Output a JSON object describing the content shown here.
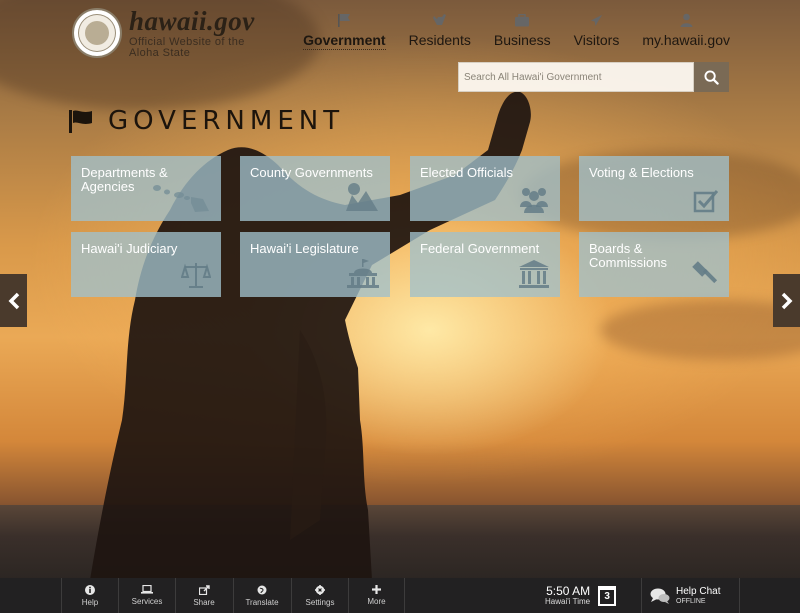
{
  "logo": {
    "title": "hawaii.gov",
    "subtitle_line1": "Official Website of the",
    "subtitle_line2": "Aloha State"
  },
  "nav": [
    {
      "label": "Government",
      "icon": "flag-icon",
      "active": true
    },
    {
      "label": "Residents",
      "icon": "shaka-icon",
      "active": false
    },
    {
      "label": "Business",
      "icon": "briefcase-icon",
      "active": false
    },
    {
      "label": "Visitors",
      "icon": "airplane-icon",
      "active": false
    },
    {
      "label": "my.hawaii.gov",
      "icon": "user-icon",
      "active": false
    }
  ],
  "search": {
    "placeholder": "Search All Hawai'i Government",
    "icon": "search-icon"
  },
  "heading": {
    "title": "GOVERNMENT",
    "icon": "flag-icon"
  },
  "tiles": [
    {
      "label": "Departments & Agencies",
      "icon": "islands-icon"
    },
    {
      "label": "County Governments",
      "icon": "county-map-icon"
    },
    {
      "label": "Elected Officials",
      "icon": "people-group-icon"
    },
    {
      "label": "Voting & Elections",
      "icon": "checkbox-icon"
    },
    {
      "label": "Hawai'i Judiciary",
      "icon": "scales-icon"
    },
    {
      "label": "Hawai'i Legislature",
      "icon": "capitol-icon"
    },
    {
      "label": "Federal Government",
      "icon": "columns-building-icon"
    },
    {
      "label": "Boards & Commissions",
      "icon": "gavel-icon"
    }
  ],
  "carousel": {
    "prev_icon": "chevron-left-icon",
    "next_icon": "chevron-right-icon"
  },
  "bottombar": {
    "items": [
      {
        "label": "Help",
        "icon": "info-icon"
      },
      {
        "label": "Services",
        "icon": "laptop-icon"
      },
      {
        "label": "Share",
        "icon": "share-icon"
      },
      {
        "label": "Translate",
        "icon": "globe-icon"
      },
      {
        "label": "Settings",
        "icon": "gear-icon"
      },
      {
        "label": "More",
        "icon": "plus-icon"
      }
    ],
    "clock": {
      "time": "5:50 AM",
      "label": "Hawai'i Time",
      "day": "3"
    },
    "chat": {
      "title": "Help Chat",
      "status": "OFFLINE",
      "icon": "chat-bubbles-icon"
    }
  }
}
